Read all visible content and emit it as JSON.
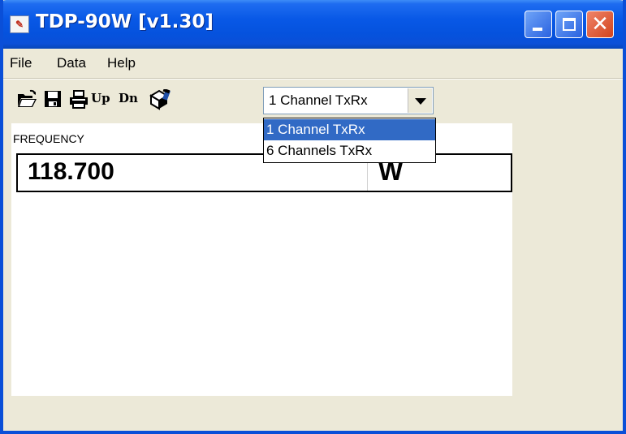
{
  "window": {
    "title": "TDP-90W [v1.30]",
    "app_icon": "app-icon"
  },
  "menubar": {
    "items": [
      {
        "label": "File"
      },
      {
        "label": "Data"
      },
      {
        "label": "Help"
      }
    ]
  },
  "toolbar": {
    "tools": [
      {
        "icon": "open-folder-icon"
      },
      {
        "icon": "save-icon"
      },
      {
        "icon": "print-icon"
      },
      {
        "label": "Up"
      },
      {
        "label": "Dn"
      },
      {
        "icon": "radio-channel-icon"
      }
    ],
    "channel_select": {
      "value": "1 Channel TxRx",
      "options": [
        "1 Channel TxRx",
        "6 Channels TxRx"
      ],
      "selected_index": 0,
      "open": true
    }
  },
  "display": {
    "frequency_label": "FREQUENCY",
    "frequency_value": "118.700",
    "mode": "W"
  },
  "colors": {
    "titlebar": "#0a4fd8",
    "window_bg": "#ece9d8",
    "selection": "#316ac5"
  }
}
